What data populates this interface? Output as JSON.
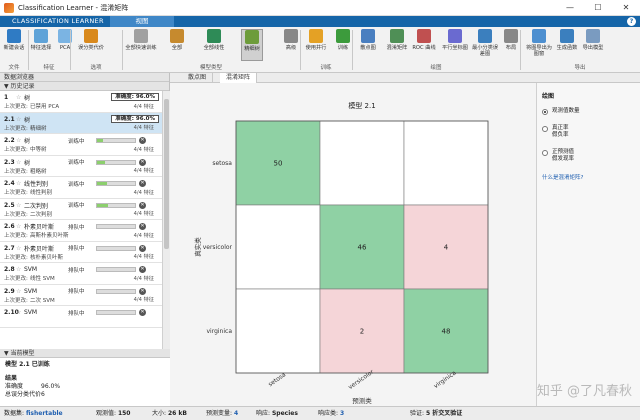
{
  "window": {
    "title": "Classification Learner - 混淆矩阵",
    "min": "—",
    "max": "☐",
    "close": "✕"
  },
  "app_tabs": {
    "main": "CLASSIFICATION LEARNER",
    "view": "视图",
    "help": "?"
  },
  "ribbon": {
    "buttons": [
      {
        "label": "新建会话",
        "icon": "new-session-icon"
      },
      {
        "label": "特征选择",
        "icon": "feature-select-icon"
      },
      {
        "label": "PCA",
        "icon": "pca-icon"
      },
      {
        "label": "误分类代价",
        "icon": "cost-icon"
      },
      {
        "label": "全部快速训练",
        "icon": "quick-train-icon"
      },
      {
        "label": "全部",
        "icon": "all-icon"
      },
      {
        "label": "全部线性",
        "icon": "all-linear-icon"
      },
      {
        "label": "精细树",
        "icon": "fine-tree-icon"
      },
      {
        "label": "高级",
        "icon": "advanced-icon"
      },
      {
        "label": "使用并行",
        "icon": "parallel-icon"
      },
      {
        "label": "训练",
        "icon": "train-icon"
      },
      {
        "label": "散点图",
        "icon": "scatter-icon"
      },
      {
        "label": "混淆矩阵",
        "icon": "confusion-icon"
      },
      {
        "label": "ROC 曲线",
        "icon": "roc-icon"
      },
      {
        "label": "平行坐标图",
        "icon": "parallel-coords-icon"
      },
      {
        "label": "最小分类误差图",
        "icon": "min-error-icon"
      },
      {
        "label": "布局",
        "icon": "layout-icon"
      },
      {
        "label": "将图导出为图窗",
        "icon": "export-fig-icon"
      },
      {
        "label": "生成函数",
        "icon": "gen-func-icon"
      },
      {
        "label": "导出模型",
        "icon": "export-model-icon"
      }
    ],
    "sections": [
      "文件",
      "特征",
      "选项",
      "模型类型",
      "训练",
      "绘图",
      "导出"
    ]
  },
  "left_panel": {
    "browser_title": "数据浏览器",
    "history_title": "历史记录",
    "current_title": "当前模型",
    "models": [
      {
        "num": "1",
        "name": "树",
        "status": "",
        "acc": "准确度: 96.0%",
        "l2_label": "上次更改:",
        "l2_value": "已禁用 PCA",
        "features": "4/4 特征",
        "progress": null
      },
      {
        "num": "2.1",
        "name": "树",
        "status": "",
        "acc": "准确度: 96.0%",
        "l2_label": "上次更改:",
        "l2_value": "精细树",
        "features": "4/4 特征",
        "progress": null
      },
      {
        "num": "2.2",
        "name": "树",
        "status": "训练中",
        "acc": "",
        "l2_label": "上次更改:",
        "l2_value": "中等树",
        "features": "4/4 特征",
        "progress": 0.15
      },
      {
        "num": "2.3",
        "name": "树",
        "status": "训练中",
        "acc": "",
        "l2_label": "上次更改:",
        "l2_value": "粗略树",
        "features": "4/4 特征",
        "progress": 0.2
      },
      {
        "num": "2.4",
        "name": "线性判别",
        "status": "训练中",
        "acc": "",
        "l2_label": "上次更改:",
        "l2_value": "线性判别",
        "features": "4/4 特征",
        "progress": 0.25
      },
      {
        "num": "2.5",
        "name": "二次判别",
        "status": "训练中",
        "acc": "",
        "l2_label": "上次更改:",
        "l2_value": "二次判别",
        "features": "4/4 特征",
        "progress": 0.3
      },
      {
        "num": "2.6",
        "name": "朴素贝叶斯",
        "status": "排队中",
        "acc": "",
        "l2_label": "上次更改:",
        "l2_value": "高斯朴素贝叶斯",
        "features": "4/4 特征",
        "progress": null
      },
      {
        "num": "2.7",
        "name": "朴素贝叶斯",
        "status": "排队中",
        "acc": "",
        "l2_label": "上次更改:",
        "l2_value": "核朴素贝叶斯",
        "features": "4/4 特征",
        "progress": null
      },
      {
        "num": "2.8",
        "name": "SVM",
        "status": "排队中",
        "acc": "",
        "l2_label": "上次更改:",
        "l2_value": "线性 SVM",
        "features": "4/4 特征",
        "progress": null
      },
      {
        "num": "2.9",
        "name": "SVM",
        "status": "排队中",
        "acc": "",
        "l2_label": "上次更改:",
        "l2_value": "二次 SVM",
        "features": "4/4 特征",
        "progress": null
      },
      {
        "num": "2.10",
        "name": "SVM",
        "status": "排队中",
        "acc": "",
        "l2_label": "",
        "l2_value": "",
        "features": "",
        "progress": null
      }
    ],
    "current_model": {
      "title_line": "模型 2.1 已训练",
      "results_header": "结果",
      "rows": [
        {
          "k": "准确度",
          "v": "96.0%"
        },
        {
          "k": "总误分类代价",
          "v": "6"
        }
      ]
    }
  },
  "doc_tabs": [
    "散点图",
    "混淆矩阵"
  ],
  "chart_data": {
    "type": "heatmap",
    "title": "模型 2.1",
    "xlabel": "预测类",
    "ylabel": "真实类",
    "categories": [
      "setosa",
      "versicolor",
      "virginica"
    ],
    "matrix": [
      [
        50,
        0,
        0
      ],
      [
        0,
        46,
        4
      ],
      [
        0,
        2,
        48
      ]
    ],
    "colors": {
      "correct": "#8fd1a4",
      "error": "#f5d5d8",
      "empty": "#ffffff"
    }
  },
  "side_panel": {
    "title": "绘图",
    "options": [
      {
        "label1": "观测值数量",
        "label2": "",
        "on": true
      },
      {
        "label1": "真正率",
        "label2": "假负率",
        "on": false
      },
      {
        "label1": "正预测值",
        "label2": "假发现率",
        "on": false
      }
    ],
    "link": "什么是混淆矩阵?"
  },
  "status_bar": [
    {
      "k": "数据集:",
      "v": "fishertable"
    },
    {
      "k": "观测值:",
      "v": "150"
    },
    {
      "k": "大小:",
      "v": "26 kB"
    },
    {
      "k": "预测变量:",
      "v": "4"
    },
    {
      "k": "响应:",
      "v": "Species"
    },
    {
      "k": "响应类:",
      "v": "3"
    },
    {
      "k": "验证:",
      "v": "5 折交叉验证"
    }
  ],
  "watermark": "知乎 @了凡春秋"
}
